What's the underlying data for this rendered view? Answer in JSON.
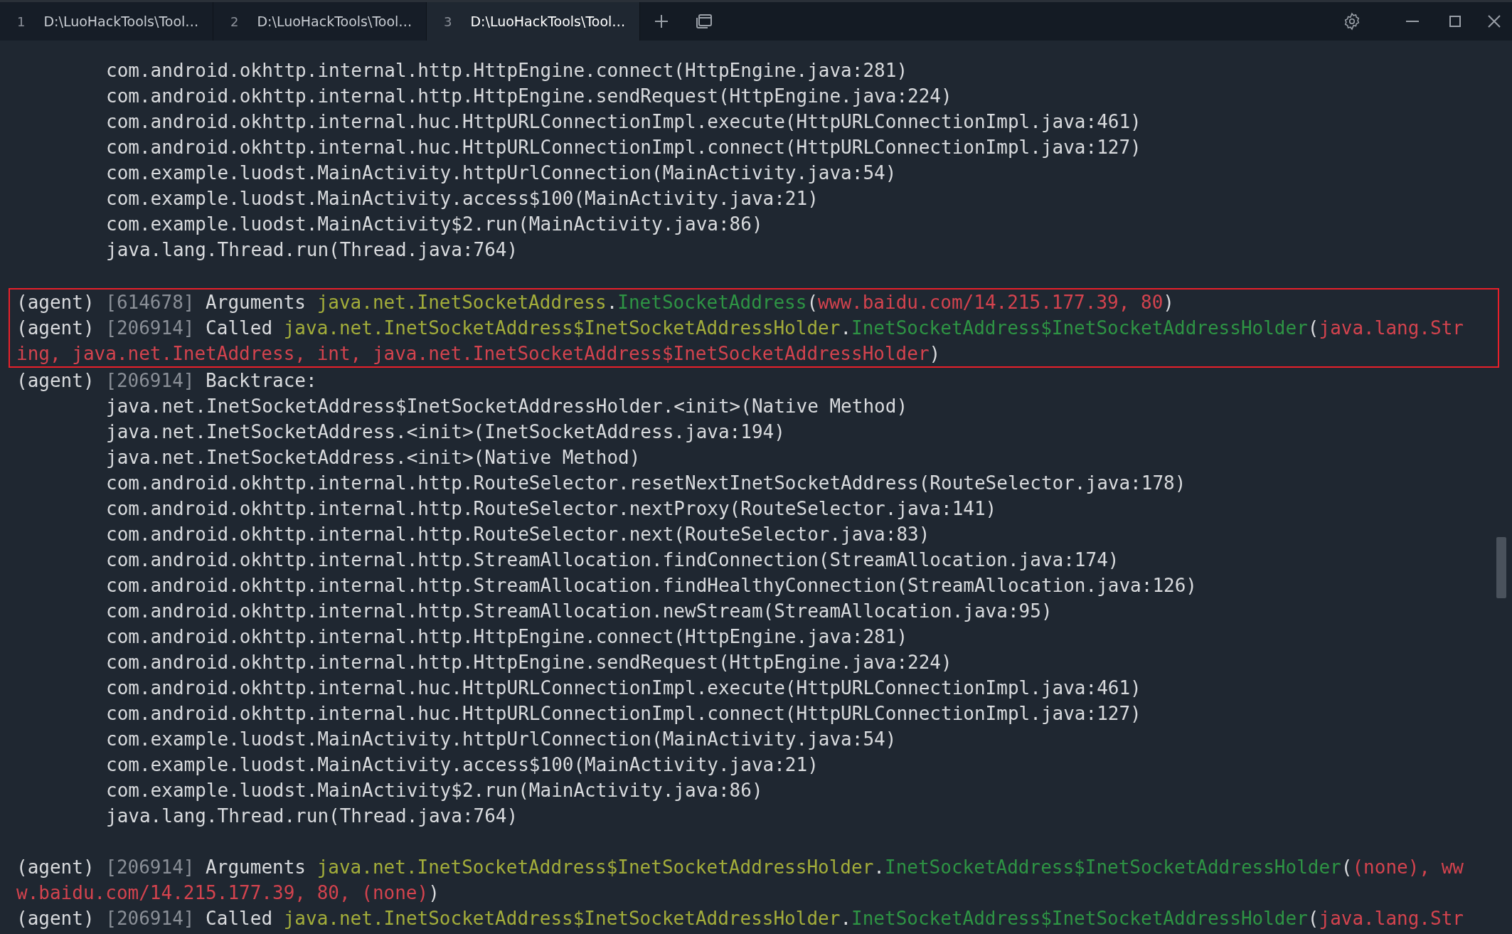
{
  "tabs": [
    {
      "number": "1",
      "title": "D:\\LuoHackTools\\Tool…",
      "selected": false
    },
    {
      "number": "2",
      "title": "D:\\LuoHackTools\\Tool…",
      "selected": false
    },
    {
      "number": "3",
      "title": "D:\\LuoHackTools\\Tool…",
      "selected": true
    }
  ],
  "lines_before": [
    {
      "kind": "trace",
      "segments": [
        {
          "kind": "plain",
          "text": "com.android.okhttp.internal.http.HttpEngine.connect(HttpEngine.java:281)"
        }
      ]
    },
    {
      "kind": "trace",
      "segments": [
        {
          "kind": "plain",
          "text": "com.android.okhttp.internal.http.HttpEngine.sendRequest(HttpEngine.java:224)"
        }
      ]
    },
    {
      "kind": "trace",
      "segments": [
        {
          "kind": "plain",
          "text": "com.android.okhttp.internal.huc.HttpURLConnectionImpl.execute(HttpURLConnectionImpl.java:461)"
        }
      ]
    },
    {
      "kind": "trace",
      "segments": [
        {
          "kind": "plain",
          "text": "com.android.okhttp.internal.huc.HttpURLConnectionImpl.connect(HttpURLConnectionImpl.java:127)"
        }
      ]
    },
    {
      "kind": "trace",
      "segments": [
        {
          "kind": "plain",
          "text": "com.example.luodst.MainActivity.httpUrlConnection(MainActivity.java:54)"
        }
      ]
    },
    {
      "kind": "trace",
      "segments": [
        {
          "kind": "plain",
          "text": "com.example.luodst.MainActivity.access$100(MainActivity.java:21)"
        }
      ]
    },
    {
      "kind": "trace",
      "segments": [
        {
          "kind": "plain",
          "text": "com.example.luodst.MainActivity$2.run(MainActivity.java:86)"
        }
      ]
    },
    {
      "kind": "trace",
      "segments": [
        {
          "kind": "plain",
          "text": "java.lang.Thread.run(Thread.java:764)"
        }
      ]
    },
    {
      "kind": "blank"
    }
  ],
  "highlight_box": {
    "lines": [
      {
        "kind": "log",
        "segments": [
          {
            "kind": "plain",
            "text": "(agent) "
          },
          {
            "kind": "pid",
            "text": "[614678]"
          },
          {
            "kind": "plain",
            "text": " Arguments "
          },
          {
            "kind": "class",
            "text": "java.net.InetSocketAddress",
            "suffix": "."
          },
          {
            "kind": "method",
            "text": "InetSocketAddress"
          },
          {
            "kind": "plain",
            "text": "("
          },
          {
            "kind": "args",
            "text": "www.baidu.com/14.215.177.39, 80"
          },
          {
            "kind": "plain",
            "text": ")"
          }
        ]
      },
      {
        "kind": "log",
        "segments": [
          {
            "kind": "plain",
            "text": "(agent) "
          },
          {
            "kind": "pid",
            "text": "[206914]"
          },
          {
            "kind": "plain",
            "text": " Called "
          },
          {
            "kind": "class",
            "text": "java.net.InetSocketAddress$InetSocketAddressHolder",
            "suffix": "."
          },
          {
            "kind": "method",
            "text": "InetSocketAddress$InetSocketAddressHolder"
          },
          {
            "kind": "plain",
            "text": "("
          },
          {
            "kind": "args",
            "text": "java.lang.Str"
          }
        ]
      },
      {
        "kind": "log",
        "segments": [
          {
            "kind": "args",
            "text": "ing, java.net.InetAddress, int, java.net.InetSocketAddress$InetSocketAddressHolder"
          },
          {
            "kind": "plain",
            "text": ")"
          }
        ]
      }
    ]
  },
  "lines_after": [
    {
      "kind": "log",
      "segments": [
        {
          "kind": "plain",
          "text": "(agent) "
        },
        {
          "kind": "pid",
          "text": "[206914]"
        },
        {
          "kind": "plain",
          "text": " Backtrace:"
        }
      ]
    },
    {
      "kind": "trace",
      "segments": [
        {
          "kind": "plain",
          "text": "java.net.InetSocketAddress$InetSocketAddressHolder.<init>(Native Method)"
        }
      ]
    },
    {
      "kind": "trace",
      "segments": [
        {
          "kind": "plain",
          "text": "java.net.InetSocketAddress.<init>(InetSocketAddress.java:194)"
        }
      ]
    },
    {
      "kind": "trace",
      "segments": [
        {
          "kind": "plain",
          "text": "java.net.InetSocketAddress.<init>(Native Method)"
        }
      ]
    },
    {
      "kind": "trace",
      "segments": [
        {
          "kind": "plain",
          "text": "com.android.okhttp.internal.http.RouteSelector.resetNextInetSocketAddress(RouteSelector.java:178)"
        }
      ]
    },
    {
      "kind": "trace",
      "segments": [
        {
          "kind": "plain",
          "text": "com.android.okhttp.internal.http.RouteSelector.nextProxy(RouteSelector.java:141)"
        }
      ]
    },
    {
      "kind": "trace",
      "segments": [
        {
          "kind": "plain",
          "text": "com.android.okhttp.internal.http.RouteSelector.next(RouteSelector.java:83)"
        }
      ]
    },
    {
      "kind": "trace",
      "segments": [
        {
          "kind": "plain",
          "text": "com.android.okhttp.internal.http.StreamAllocation.findConnection(StreamAllocation.java:174)"
        }
      ]
    },
    {
      "kind": "trace",
      "segments": [
        {
          "kind": "plain",
          "text": "com.android.okhttp.internal.http.StreamAllocation.findHealthyConnection(StreamAllocation.java:126)"
        }
      ]
    },
    {
      "kind": "trace",
      "segments": [
        {
          "kind": "plain",
          "text": "com.android.okhttp.internal.http.StreamAllocation.newStream(StreamAllocation.java:95)"
        }
      ]
    },
    {
      "kind": "trace",
      "segments": [
        {
          "kind": "plain",
          "text": "com.android.okhttp.internal.http.HttpEngine.connect(HttpEngine.java:281)"
        }
      ]
    },
    {
      "kind": "trace",
      "segments": [
        {
          "kind": "plain",
          "text": "com.android.okhttp.internal.http.HttpEngine.sendRequest(HttpEngine.java:224)"
        }
      ]
    },
    {
      "kind": "trace",
      "segments": [
        {
          "kind": "plain",
          "text": "com.android.okhttp.internal.huc.HttpURLConnectionImpl.execute(HttpURLConnectionImpl.java:461)"
        }
      ]
    },
    {
      "kind": "trace",
      "segments": [
        {
          "kind": "plain",
          "text": "com.android.okhttp.internal.huc.HttpURLConnectionImpl.connect(HttpURLConnectionImpl.java:127)"
        }
      ]
    },
    {
      "kind": "trace",
      "segments": [
        {
          "kind": "plain",
          "text": "com.example.luodst.MainActivity.httpUrlConnection(MainActivity.java:54)"
        }
      ]
    },
    {
      "kind": "trace",
      "segments": [
        {
          "kind": "plain",
          "text": "com.example.luodst.MainActivity.access$100(MainActivity.java:21)"
        }
      ]
    },
    {
      "kind": "trace",
      "segments": [
        {
          "kind": "plain",
          "text": "com.example.luodst.MainActivity$2.run(MainActivity.java:86)"
        }
      ]
    },
    {
      "kind": "trace",
      "segments": [
        {
          "kind": "plain",
          "text": "java.lang.Thread.run(Thread.java:764)"
        }
      ]
    },
    {
      "kind": "blank"
    },
    {
      "kind": "log",
      "segments": [
        {
          "kind": "plain",
          "text": "(agent) "
        },
        {
          "kind": "pid",
          "text": "[206914]"
        },
        {
          "kind": "plain",
          "text": " Arguments "
        },
        {
          "kind": "class",
          "text": "java.net.InetSocketAddress$InetSocketAddressHolder",
          "suffix": "."
        },
        {
          "kind": "method",
          "text": "InetSocketAddress$InetSocketAddressHolder"
        },
        {
          "kind": "plain",
          "text": "("
        },
        {
          "kind": "args",
          "text": "(none), ww"
        }
      ]
    },
    {
      "kind": "log",
      "segments": [
        {
          "kind": "args",
          "text": "w.baidu.com/14.215.177.39, 80, (none)"
        },
        {
          "kind": "plain",
          "text": ")"
        }
      ]
    },
    {
      "kind": "log",
      "segments": [
        {
          "kind": "plain",
          "text": "(agent) "
        },
        {
          "kind": "pid",
          "text": "[206914]"
        },
        {
          "kind": "plain",
          "text": " Called "
        },
        {
          "kind": "class",
          "text": "java.net.InetSocketAddress$InetSocketAddressHolder",
          "suffix": "."
        },
        {
          "kind": "method",
          "text": "InetSocketAddress$InetSocketAddressHolder"
        },
        {
          "kind": "plain",
          "text": "("
        },
        {
          "kind": "args",
          "text": "java.lang.Str"
        }
      ]
    }
  ]
}
